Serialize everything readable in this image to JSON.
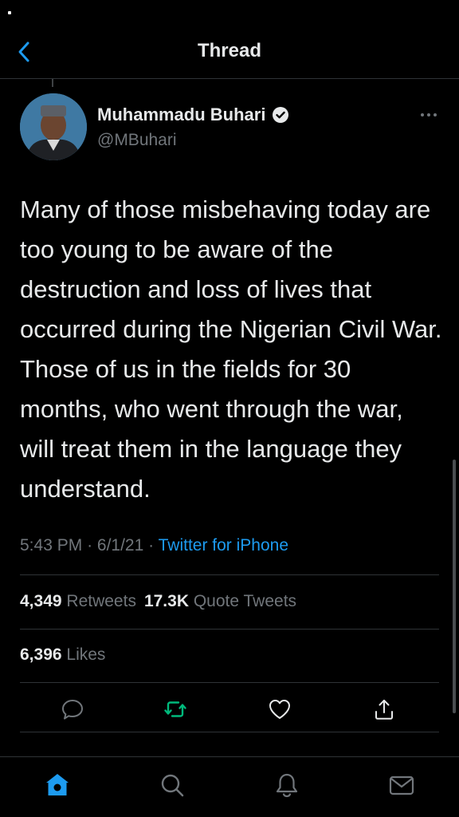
{
  "header": {
    "title": "Thread"
  },
  "tweet": {
    "author_name": "Muhammadu Buhari",
    "handle": "@MBuhari",
    "text": "Many of those misbehaving today are too young to be aware of the destruction and loss of lives that occurred during the Nigerian Civil War. Those of us in the fields for 30 months, who went through the war, will treat them in the language they understand.",
    "time": "5:43 PM",
    "date": "6/1/21",
    "separator": "·",
    "source": "Twitter for iPhone"
  },
  "stats": {
    "retweets_count": "4,349",
    "retweets_label": "Retweets",
    "quotes_count": "17.3K",
    "quotes_label": "Quote Tweets",
    "likes_count": "6,396",
    "likes_label": "Likes"
  },
  "icons": {
    "back": "chevron-left-icon",
    "verified": "verified-badge-icon",
    "more": "more-horizontal-icon",
    "reply": "reply-icon",
    "retweet": "retweet-icon",
    "like": "heart-icon",
    "share": "share-icon",
    "home": "home-icon",
    "search": "search-icon",
    "notifications": "bell-icon",
    "messages": "mail-icon"
  },
  "colors": {
    "background": "#000000",
    "accent": "#1d9bf0",
    "retweet_active": "#00ba7c",
    "muted": "#71767b",
    "text": "#e7e9ea"
  }
}
